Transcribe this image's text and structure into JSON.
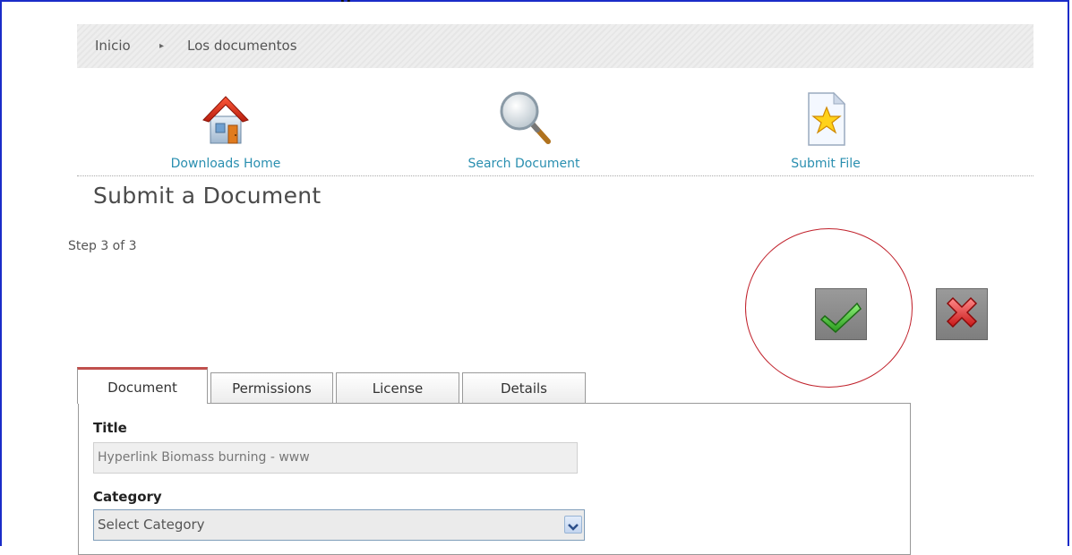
{
  "header": {
    "title_fragment": "g"
  },
  "breadcrumb": {
    "home": "Inicio",
    "separator": "▸",
    "current": "Los documentos"
  },
  "nav": {
    "items": [
      {
        "label": "Downloads Home",
        "icon": "house-icon"
      },
      {
        "label": "Search Document",
        "icon": "magnifier-icon"
      },
      {
        "label": "Submit File",
        "icon": "file-star-icon"
      }
    ]
  },
  "page": {
    "title": "Submit a Document",
    "step": "Step 3 of 3"
  },
  "actions": {
    "confirm_icon": "checkmark-icon",
    "cancel_icon": "x-icon"
  },
  "tabs": [
    {
      "label": "Document",
      "active": true
    },
    {
      "label": "Permissions",
      "active": false
    },
    {
      "label": "License",
      "active": false
    },
    {
      "label": "Details",
      "active": false
    }
  ],
  "form": {
    "title_label": "Title",
    "title_value": "Hyperlink Biomass burning - www",
    "category_label": "Category",
    "category_value": "Select Category"
  },
  "colors": {
    "link": "#2a8fb0",
    "active_tab_accent": "#c0504d",
    "highlight_circle": "#c0202a",
    "window_border": "#1a2cc8"
  }
}
